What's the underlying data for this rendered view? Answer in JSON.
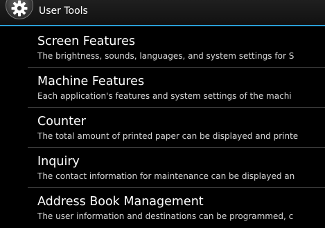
{
  "header": {
    "title": "User Tools",
    "icon": "gear-icon",
    "accent_color": "#2a9fd6"
  },
  "items": [
    {
      "title": "Screen Features",
      "description": "The brightness, sounds, languages, and system settings for S"
    },
    {
      "title": "Machine Features",
      "description": "Each application's features and system settings of the machi"
    },
    {
      "title": "Counter",
      "description": "The total amount of printed paper can be displayed and printe"
    },
    {
      "title": "Inquiry",
      "description": "The contact information for maintenance can be displayed an"
    },
    {
      "title": "Address Book Management",
      "description": "The user information and destinations can be programmed, c"
    }
  ]
}
